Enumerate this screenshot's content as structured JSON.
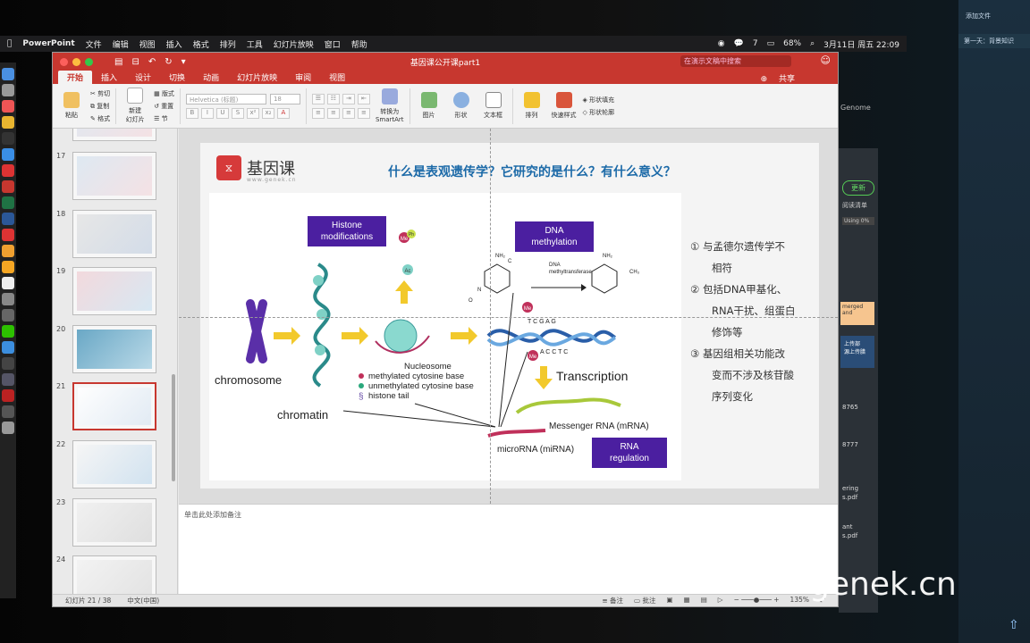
{
  "menubar": {
    "app": "PowerPoint",
    "items": [
      "文件",
      "编辑",
      "视图",
      "插入",
      "格式",
      "排列",
      "工具",
      "幻灯片放映",
      "窗口",
      "帮助"
    ],
    "battery": "68%",
    "wechat_count": "7",
    "datetime": "3月11日 周五  22:09"
  },
  "window": {
    "title": "基因课公开课part1",
    "search_placeholder": "在演示文稿中搜索",
    "share": "共享",
    "tabs": [
      "开始",
      "插入",
      "设计",
      "切换",
      "动画",
      "幻灯片放映",
      "审阅",
      "视图"
    ],
    "active_tab": "开始"
  },
  "ribbon": {
    "paste": "粘贴",
    "cut": "剪切",
    "copy": "复制",
    "format": "格式",
    "new_slide": "新建\n幻灯片",
    "layout": "版式",
    "reset": "重置",
    "section": "节",
    "font_name": "Helvetica (标题)",
    "font_size": "18",
    "convert": "转换为\nSmartArt",
    "picture": "图片",
    "shape": "形状",
    "textbox": "文本框",
    "arrange": "排列",
    "quick_styles": "快速样式",
    "shape_fill": "形状填充",
    "shape_outline": "形状轮廓"
  },
  "thumbnails": [
    {
      "num": "17"
    },
    {
      "num": "18"
    },
    {
      "num": "19"
    },
    {
      "num": "20"
    },
    {
      "num": "21",
      "selected": true
    },
    {
      "num": "22"
    },
    {
      "num": "23"
    },
    {
      "num": "24"
    }
  ],
  "slide": {
    "logo_name": "基因课",
    "logo_url": "www.genek.cn",
    "title": "什么是表观遗传学？它研究的是什么？有什么意义？",
    "figure": {
      "histone": "Histone\nmodifications",
      "dna_meth": "DNA\nmethylation",
      "dnmt": "DNA\nmethyltransferase",
      "chromosome": "chromosome",
      "chromatin": "chromatin",
      "nucleosome": "Nucleosome",
      "legend1": "methylated cytosine base",
      "legend2": "unmethylated cytosine base",
      "legend3": "histone tail",
      "transcription": "Transcription",
      "mrna": "Messenger RNA (mRNA)",
      "mirna": "microRNA (miRNA)",
      "rna_reg": "RNA\nregulation",
      "me": "Me",
      "ph": "Ph",
      "ac": "Ac",
      "nh2": "NH₂",
      "ch3": "CH₃",
      "n": "N",
      "c": "C",
      "o": "O",
      "bases": "T C G A G",
      "bases2": "A C C T C"
    },
    "notes_right": [
      "①  与孟德尔遗传学不",
      "相符",
      "②  包括DNA甲基化、",
      "RNA干扰、组蛋白",
      "修饰等",
      "③  基因组相关功能改",
      "变而不涉及核苷酸",
      "序列变化"
    ]
  },
  "notes_placeholder": "单击此处添加备注",
  "status": {
    "slide_pos": "幻灯片 21 / 38",
    "lang": "中文(中国)",
    "notes_btn": "备注",
    "comments_btn": "批注",
    "zoom": "135%"
  },
  "right_panel": {
    "add_file": "添加文件",
    "caption": "第一天：背景知识",
    "genome": "Genome",
    "update": "更新",
    "reading_list": "阅读清单",
    "using": "Using 0%",
    "merged": "merged and",
    "upload1": "上传部",
    "upload2": "源上传腊",
    "n1": "8765",
    "n2": "8777",
    "f1": "ering",
    "f2": "s.pdf",
    "f3": "ant",
    "f4": "s.pdf"
  },
  "watermark": "genek.cn",
  "colors": {
    "ppt_red": "#c7372f",
    "slide_title": "#1c6aa8",
    "label_purple": "#4b1fa0"
  }
}
